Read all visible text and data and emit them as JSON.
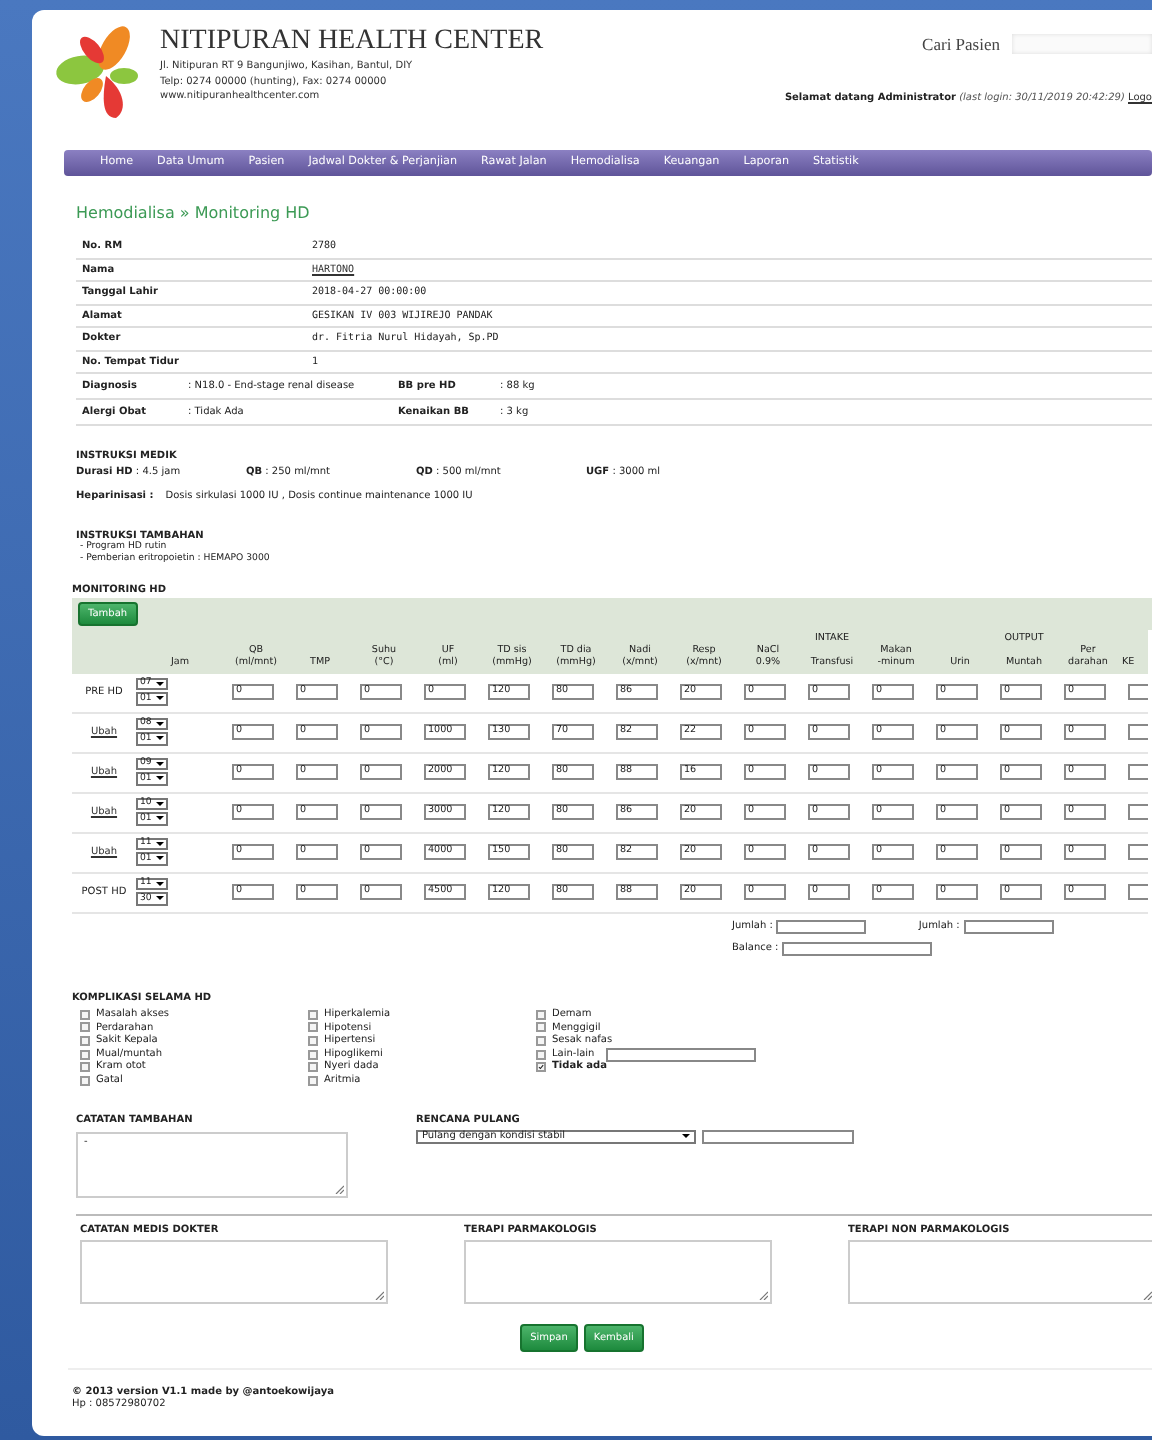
{
  "header": {
    "title": "NITIPURAN HEALTH CENTER",
    "address_lines": [
      "Jl. Nitipuran RT 9 Bangunjiwo, Kasihan, Bantul, DIY",
      "Telp: 0274 00000 (hunting), Fax: 0274 00000",
      "www.nitipuranhealthcenter.com"
    ],
    "search_label": "Cari Pasien",
    "welcome": "Selamat datang Administrator",
    "last_login": "(last login: 30/11/2019 20:42:29)",
    "logout": "Logo"
  },
  "nav": [
    {
      "label": "Home"
    },
    {
      "label": "Data Umum"
    },
    {
      "label": "Pasien"
    },
    {
      "label": "Jadwal Dokter & Perjanjian"
    },
    {
      "label": "Rawat Jalan"
    },
    {
      "label": "Hemodialisa"
    },
    {
      "label": "Keuangan"
    },
    {
      "label": "Laporan"
    },
    {
      "label": "Statistik"
    }
  ],
  "breadcrumb": {
    "parent": "Hemodialisa",
    "separator": "»",
    "current": "Monitoring HD"
  },
  "patient": [
    {
      "label": "No. RM",
      "value": "2780",
      "kind": "text"
    },
    {
      "label": "Nama",
      "value": "HARTONO",
      "kind": "link"
    },
    {
      "label": "Tanggal Lahir",
      "value": "2018-04-27 00:00:00",
      "kind": "text"
    },
    {
      "label": "Alamat",
      "value": "GESIKAN IV 003 WIJIREJO PANDAK",
      "kind": "text"
    },
    {
      "label": "Dokter",
      "value": "dr. Fitria Nurul Hidayah, Sp.PD",
      "kind": "text"
    },
    {
      "label": "No. Tempat Tidur",
      "value": "1",
      "kind": "text"
    }
  ],
  "patient_pairs": [
    {
      "left": {
        "label": "Diagnosis",
        "value": ": N18.0 - End-stage renal disease"
      },
      "right": {
        "label": "BB pre HD",
        "value": ": 88 kg"
      }
    },
    {
      "left": {
        "label": "Alergi Obat",
        "value": ": Tidak Ada"
      },
      "right": {
        "label": "Kenaikan BB",
        "value": ": 3 kg"
      }
    }
  ],
  "medical_instructions": {
    "title": "INSTRUKSI MEDIK",
    "items": [
      {
        "label": "Durasi HD",
        "value": ": 4.5 jam"
      },
      {
        "label": "QB",
        "value": ": 250 ml/mnt"
      },
      {
        "label": "QD",
        "value": ": 500 ml/mnt"
      },
      {
        "label": "UGF",
        "value": ": 3000 ml"
      }
    ],
    "heparin_label": "Heparinisasi :",
    "heparin_value": "Dosis sirkulasi 1000 IU , Dosis continue maintenance 1000 IU"
  },
  "additional_instructions": {
    "title": "INSTRUKSI TAMBAHAN",
    "lines": [
      "- Program HD rutin",
      "- Pemberian eritropoietin : HEMAPO 3000"
    ]
  },
  "monitoring": {
    "title": "MONITORING HD",
    "add_button": "Tambah",
    "jam_label": "Jam",
    "groups": {
      "intake": "INTAKE",
      "output": "OUTPUT"
    },
    "columns": [
      {
        "label": "QB\n(ml/mnt)",
        "kind": "plain"
      },
      {
        "label": "TMP",
        "kind": "plain"
      },
      {
        "label": "Suhu\n(°C)",
        "kind": "plain"
      },
      {
        "label": "UF\n(ml)",
        "kind": "plain"
      },
      {
        "label": "TD sis\n(mmHg)",
        "kind": "plain"
      },
      {
        "label": "TD dia\n(mmHg)",
        "kind": "plain"
      },
      {
        "label": "Nadi\n(x/mnt)",
        "kind": "plain"
      },
      {
        "label": "Resp\n(x/mnt)",
        "kind": "plain"
      },
      {
        "label": "NaCl\n0.9%",
        "kind": "intake"
      },
      {
        "label": "Transfusi",
        "kind": "intake"
      },
      {
        "label": "Makan\n-minum",
        "kind": "intake"
      },
      {
        "label": "Urin",
        "kind": "output"
      },
      {
        "label": "Muntah",
        "kind": "output"
      },
      {
        "label": "Per\ndarahan",
        "kind": "output"
      },
      {
        "label": "KE",
        "kind": "plain"
      }
    ],
    "rows": [
      {
        "label": "PRE HD",
        "kind": "text",
        "hour": "07",
        "minute": "01",
        "values": [
          "0",
          "0",
          "0",
          "0",
          "120",
          "80",
          "86",
          "20",
          "0",
          "0",
          "0",
          "0",
          "0",
          "0"
        ]
      },
      {
        "label": "Ubah",
        "kind": "link",
        "hour": "08",
        "minute": "01",
        "values": [
          "0",
          "0",
          "0",
          "1000",
          "130",
          "70",
          "82",
          "22",
          "0",
          "0",
          "0",
          "0",
          "0",
          "0"
        ]
      },
      {
        "label": "Ubah",
        "kind": "link",
        "hour": "09",
        "minute": "01",
        "values": [
          "0",
          "0",
          "0",
          "2000",
          "120",
          "80",
          "88",
          "16",
          "0",
          "0",
          "0",
          "0",
          "0",
          "0"
        ]
      },
      {
        "label": "Ubah",
        "kind": "link",
        "hour": "10",
        "minute": "01",
        "values": [
          "0",
          "0",
          "0",
          "3000",
          "120",
          "80",
          "86",
          "20",
          "0",
          "0",
          "0",
          "0",
          "0",
          "0"
        ]
      },
      {
        "label": "Ubah",
        "kind": "link",
        "hour": "11",
        "minute": "01",
        "values": [
          "0",
          "0",
          "0",
          "4000",
          "150",
          "80",
          "82",
          "20",
          "0",
          "0",
          "0",
          "0",
          "0",
          "0"
        ]
      },
      {
        "label": "POST HD",
        "kind": "text",
        "hour": "11",
        "minute": "30",
        "values": [
          "0",
          "0",
          "0",
          "4500",
          "120",
          "80",
          "88",
          "20",
          "0",
          "0",
          "0",
          "0",
          "0",
          "0"
        ]
      }
    ],
    "intake_total_label": "Jumlah :",
    "output_total_label": "Jumlah :",
    "balance_label": "Balance :"
  },
  "complications": {
    "title": "KOMPLIKASI SELAMA HD",
    "columns": [
      {
        "items": [
          {
            "label": "Masalah akses",
            "checked": false,
            "kind": "plain"
          },
          {
            "label": "Perdarahan",
            "checked": false,
            "kind": "plain"
          },
          {
            "label": "Sakit Kepala",
            "checked": false,
            "kind": "plain"
          },
          {
            "label": "Mual/muntah",
            "checked": false,
            "kind": "plain"
          },
          {
            "label": "Kram otot",
            "checked": false,
            "kind": "plain"
          },
          {
            "label": "Gatal",
            "checked": false,
            "kind": "plain"
          }
        ]
      },
      {
        "items": [
          {
            "label": "Hiperkalemia",
            "checked": false,
            "kind": "plain"
          },
          {
            "label": "Hipotensi",
            "checked": false,
            "kind": "plain"
          },
          {
            "label": "Hipertensi",
            "checked": false,
            "kind": "plain"
          },
          {
            "label": "Hipoglikemi",
            "checked": false,
            "kind": "plain"
          },
          {
            "label": "Nyeri dada",
            "checked": false,
            "kind": "plain"
          },
          {
            "label": "Aritmia",
            "checked": false,
            "kind": "plain"
          }
        ]
      },
      {
        "items": [
          {
            "label": "Demam",
            "checked": false,
            "kind": "plain"
          },
          {
            "label": "Menggigil",
            "checked": false,
            "kind": "plain"
          },
          {
            "label": "Sesak nafas",
            "checked": false,
            "kind": "plain"
          },
          {
            "label": "Lain-lain",
            "checked": false,
            "kind": "with_input"
          },
          {
            "label": "Tidak ada",
            "checked": true,
            "kind": "plain"
          }
        ]
      }
    ]
  },
  "notes": {
    "title": "CATATAN TAMBAHAN",
    "value": "-"
  },
  "discharge": {
    "title": "RENCANA PULANG",
    "selected": "Pulang dengan kondisi stabil"
  },
  "doctor_fields": [
    {
      "title": "CATATAN MEDIS DOKTER"
    },
    {
      "title": "TERAPI PARMAKOLOGIS"
    },
    {
      "title": "TERAPI NON PARMAKOLOGIS"
    }
  ],
  "buttons": [
    "Simpan",
    "Kembali"
  ],
  "footer": {
    "line1": "© 2013 version V1.1 made by @antoekowijaya",
    "line2": "Hp : 08572980702"
  }
}
